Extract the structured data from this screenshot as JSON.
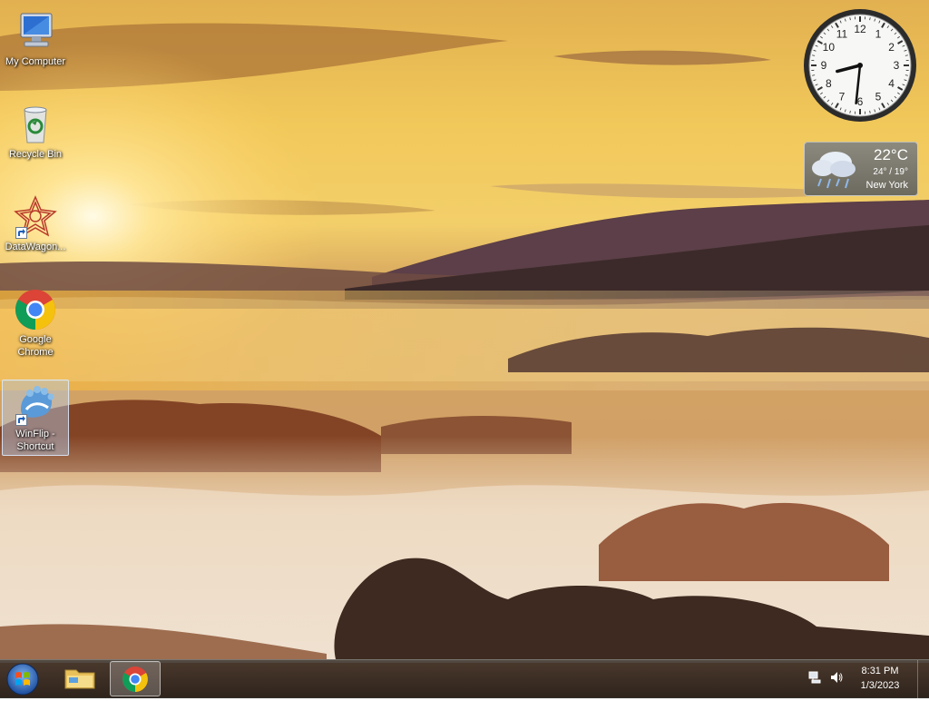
{
  "desktop": {
    "icons": [
      {
        "label": "My Computer",
        "icon": "computer-icon"
      },
      {
        "label": "Recycle Bin",
        "icon": "recycle-bin-icon"
      },
      {
        "label": "DataWagon...",
        "icon": "datawagon-icon",
        "shortcut": true
      },
      {
        "label": "Google\nChrome",
        "icon": "chrome-icon"
      },
      {
        "label": "WinFlip -\nShortcut",
        "icon": "winflip-icon",
        "shortcut": true,
        "selected": true
      }
    ]
  },
  "gadgets": {
    "clock": {
      "numbers": [
        "12",
        "1",
        "2",
        "3",
        "4",
        "5",
        "6",
        "7",
        "8",
        "9",
        "10",
        "11"
      ],
      "hour": 8,
      "minute": 31
    },
    "weather": {
      "temperature": "22°C",
      "range": "24° / 19°",
      "city": "New York",
      "icon": "rain-cloud-icon"
    }
  },
  "taskbar": {
    "start": "windows-start-icon",
    "pinned": [
      {
        "name": "Windows Explorer",
        "icon": "folder-icon"
      },
      {
        "name": "Google Chrome",
        "icon": "chrome-icon",
        "active": true
      }
    ],
    "tray": {
      "network": "network-icon",
      "volume": "volume-icon"
    },
    "clock": {
      "time": "8:31 PM",
      "date": "1/3/2023"
    }
  },
  "colors": {
    "taskbar": "#2a2019",
    "sky": "#f0c040",
    "accent": "#f5b81c"
  }
}
